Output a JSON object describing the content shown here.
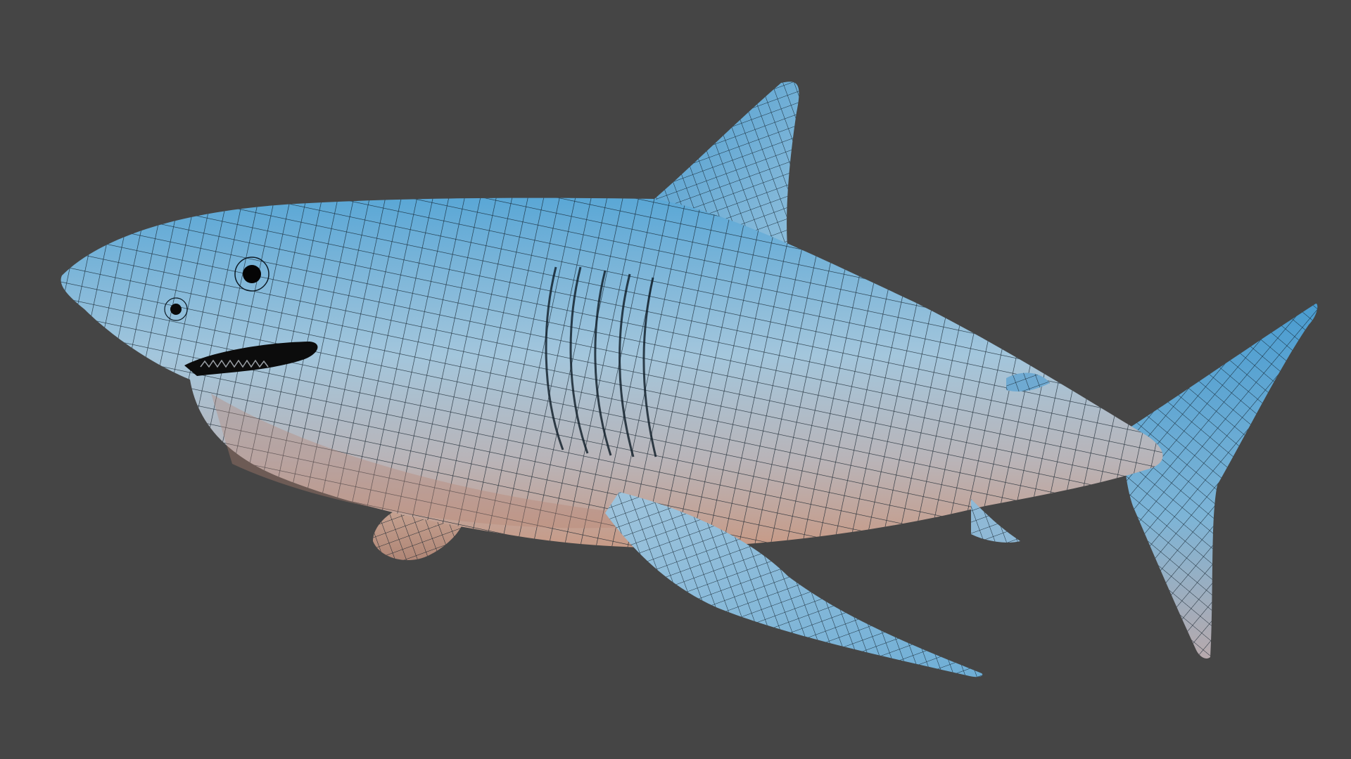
{
  "scene": {
    "subject": "shark-wireframe-model",
    "colors": {
      "background": "#454545",
      "body_top": "#4f9fd0",
      "body_mid": "#8fbcd8",
      "body_under": "#c9a08c",
      "wire": "#0d1b26",
      "eye": "#050505",
      "mouth": "#0c0c0c"
    }
  }
}
